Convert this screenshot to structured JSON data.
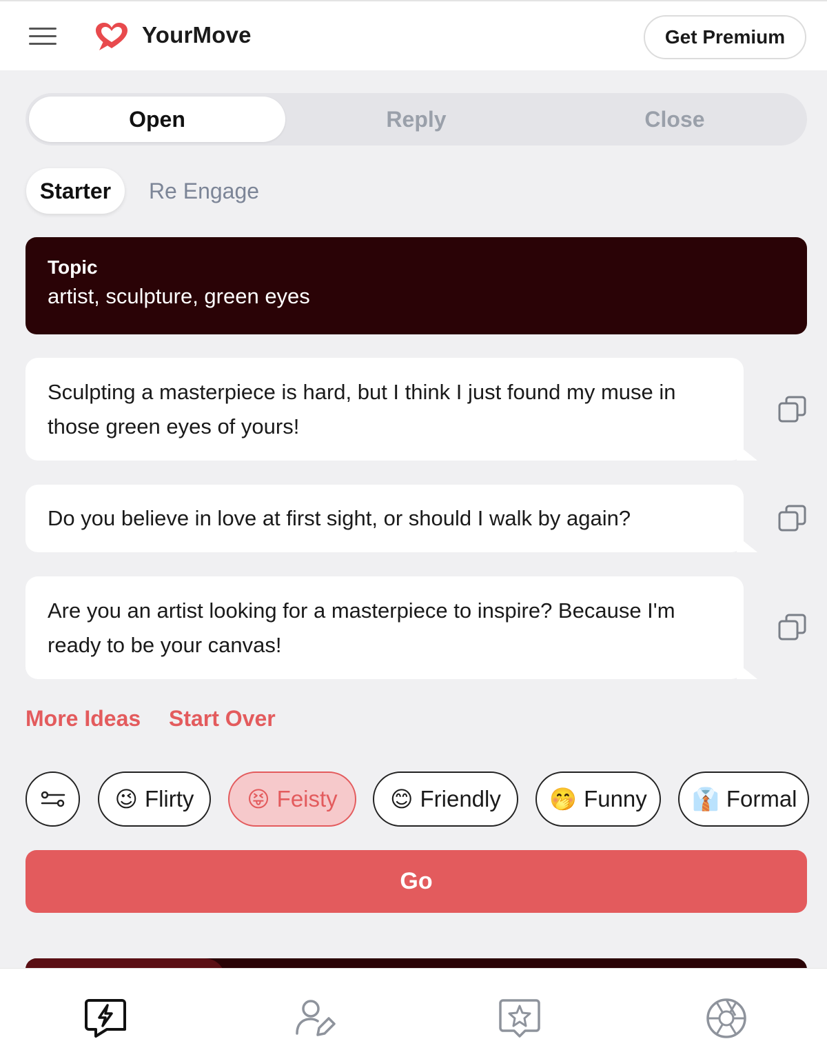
{
  "app": {
    "brand": "YourMove",
    "premium_label": "Get Premium",
    "accent_color": "#e35b5d",
    "topic_bg_color": "#2a0306"
  },
  "mode_tabs": [
    {
      "label": "Open",
      "active": true
    },
    {
      "label": "Reply",
      "active": false
    },
    {
      "label": "Close",
      "active": false
    }
  ],
  "sub_tabs": [
    {
      "label": "Starter",
      "active": true
    },
    {
      "label": "Re Engage",
      "active": false
    }
  ],
  "topic": {
    "label": "Topic",
    "value": "artist, sculpture, green eyes"
  },
  "suggestions": [
    {
      "text": "Sculpting a masterpiece is hard, but I think I just found my muse in those green eyes of yours!",
      "icon": "copy-icon"
    },
    {
      "text": "Do you believe in love at first sight, or should I walk by again?",
      "icon": "copy-icon"
    },
    {
      "text": "Are you an artist looking for a masterpiece to inspire? Because I'm ready to be your canvas!",
      "icon": "copy-icon"
    }
  ],
  "actions": {
    "more_ideas": "More Ideas",
    "start_over": "Start Over"
  },
  "tones": [
    {
      "emoji": "😉",
      "label": "Flirty",
      "selected": false
    },
    {
      "emoji": "😝",
      "label": "Feisty",
      "selected": true
    },
    {
      "emoji": "😊",
      "label": "Friendly",
      "selected": false
    },
    {
      "emoji": "🤭",
      "label": "Funny",
      "selected": false
    },
    {
      "emoji": "👔",
      "label": "Formal",
      "selected": false
    }
  ],
  "go_label": "Go",
  "bottom_nav": [
    {
      "icon": "lightning-chat-icon",
      "active": true
    },
    {
      "icon": "profile-edit-icon",
      "active": false
    },
    {
      "icon": "star-badge-icon",
      "active": false
    },
    {
      "icon": "camera-aperture-icon",
      "active": false
    }
  ]
}
